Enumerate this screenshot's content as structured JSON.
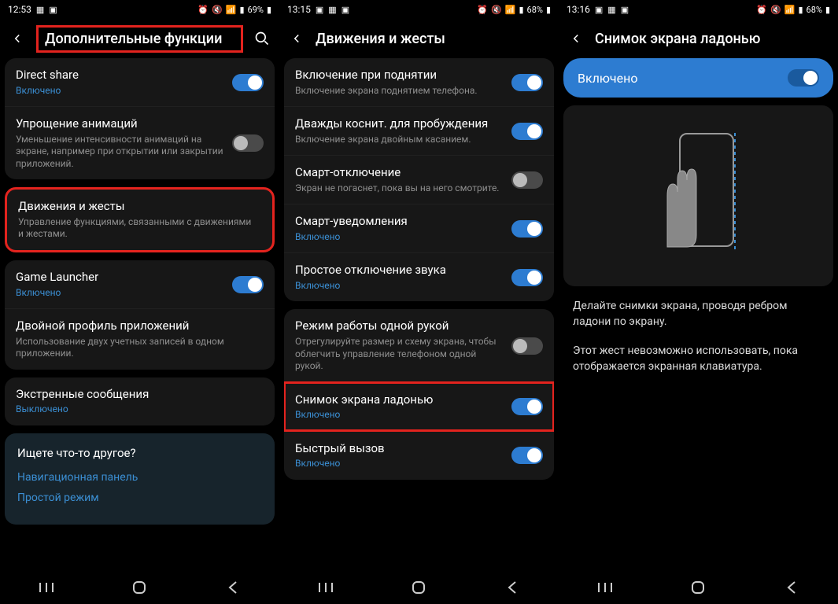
{
  "phone1": {
    "status": {
      "time": "12:53",
      "battery": "69%"
    },
    "title": "Дополнительные функции",
    "rows": [
      {
        "title": "Direct share",
        "sub": "Включено",
        "subBlue": true,
        "toggle": "on"
      },
      {
        "title": "Упрощение анимаций",
        "sub": "Уменьшение интенсивности анимаций на экране, например при открытии или закрытии приложений.",
        "toggle": "off"
      },
      {
        "title": "Движения и жесты",
        "sub": "Управление функциями, связанными с движениями и жестами.",
        "highlighted": true
      },
      {
        "title": "Game Launcher",
        "sub": "Включено",
        "subBlue": true,
        "toggle": "on"
      },
      {
        "title": "Двойной профиль приложений",
        "sub": "Использование двух учетных записей в одном приложении."
      },
      {
        "title": "Экстренные сообщения",
        "sub": "Выключено",
        "subBlue": true
      }
    ],
    "search": {
      "prompt": "Ищете что-то другое?",
      "links": [
        "Навигационная панель",
        "Простой режим"
      ]
    }
  },
  "phone2": {
    "status": {
      "time": "13:15",
      "battery": "68%"
    },
    "title": "Движения и жесты",
    "rows": [
      {
        "title": "Включение при поднятии",
        "sub": "Включение экрана поднятием телефона.",
        "toggle": "on"
      },
      {
        "title": "Дважды коснит. для пробуждения",
        "sub": "Включение экрана двойным касанием.",
        "toggle": "on"
      },
      {
        "title": "Смарт-отключение",
        "sub": "Экран не погаснет, пока вы на него смотрите.",
        "toggle": "off"
      },
      {
        "title": "Смарт-уведомления",
        "sub": "Включено",
        "subBlue": true,
        "toggle": "on"
      },
      {
        "title": "Простое отключение звука",
        "sub": "Включено",
        "subBlue": true,
        "toggle": "on"
      },
      {
        "title": "Режим работы одной рукой",
        "sub": "Отрегулируйте размер и схему экрана, чтобы облегчить управление телефоном одной рукой.",
        "toggle": "off"
      },
      {
        "title": "Снимок экрана ладонью",
        "sub": "Включено",
        "subBlue": true,
        "toggle": "on",
        "highlighted": true
      },
      {
        "title": "Быстрый вызов",
        "sub": "Включено",
        "subBlue": true,
        "toggle": "on"
      }
    ]
  },
  "phone3": {
    "status": {
      "time": "13:16",
      "battery": "68%"
    },
    "title": "Снимок экрана ладонью",
    "enabled_label": "Включено",
    "desc1": "Делайте снимки экрана, проводя ребром ладони по экрану.",
    "desc2": "Этот жест невозможно использовать, пока отображается экранная клавиатура."
  }
}
